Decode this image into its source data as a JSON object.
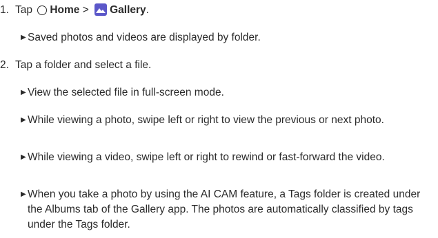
{
  "steps": [
    {
      "number": "1.",
      "tap": "Tap",
      "home": "Home",
      "separator": ">",
      "gallery": "Gallery",
      "end": ".",
      "home_icon": "circle-home-icon",
      "gallery_icon": "gallery-app-icon",
      "gallery_icon_color": "#5b57c9",
      "bullets": [
        "Saved photos and videos are displayed by folder."
      ]
    },
    {
      "number": "2.",
      "text": "Tap a folder and select a file.",
      "bullets": [
        "View the selected file in full-screen mode.",
        "While viewing a photo, swipe left or right to view the previous or next photo.",
        "While viewing a video, swipe left or right to rewind or fast-forward the video.",
        "When you take a photo by using the AI CAM feature, a Tags folder is created under the Albums tab of the Gallery app. The photos are automatically classified by tags under the Tags folder."
      ]
    }
  ],
  "bullet_marker": "▶"
}
